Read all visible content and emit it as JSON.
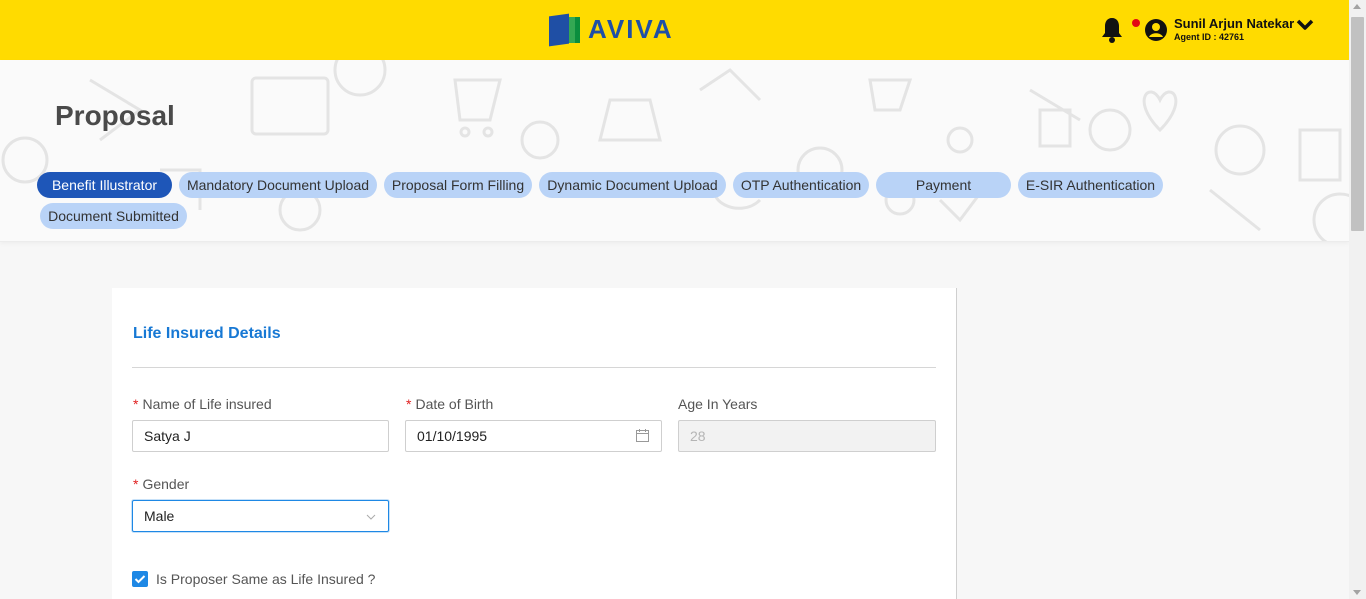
{
  "header": {
    "logo_text": "AVIVA",
    "brand_color": "#ffdb00",
    "user_name": "Sunil Arjun Natekar",
    "agent_id": "Agent ID : 42761",
    "icons": [
      "bell-icon",
      "notification-dot",
      "user-avatar-icon",
      "chevron-down-icon"
    ]
  },
  "page": {
    "title": "Proposal"
  },
  "steps": [
    {
      "label": "Benefit Illustrator",
      "active": true
    },
    {
      "label": "Mandatory Document Upload",
      "active": false
    },
    {
      "label": "Proposal Form Filling",
      "active": false
    },
    {
      "label": "Dynamic Document Upload",
      "active": false
    },
    {
      "label": "OTP Authentication",
      "active": false
    },
    {
      "label": "Payment",
      "active": false
    },
    {
      "label": "E-SIR Authentication",
      "active": false
    },
    {
      "label": "Document Submitted",
      "active": false
    }
  ],
  "form": {
    "section_title": "Life Insured Details",
    "required_mark": "*",
    "name": {
      "label": "Name of Life insured",
      "value": "Satya J"
    },
    "dob": {
      "label": "Date of Birth",
      "value": "01/10/1995"
    },
    "age": {
      "label": "Age In Years",
      "value": "28"
    },
    "gender": {
      "label": "Gender",
      "value": "Male"
    },
    "proposer_same": {
      "label": "Is Proposer Same as Life Insured ?",
      "checked": true
    }
  },
  "colors": {
    "step_active": "#1e56b8",
    "step_inactive": "#b9d3f7",
    "section_title": "#1778d4",
    "required": "#e02020",
    "checkbox": "#1e88e5"
  }
}
